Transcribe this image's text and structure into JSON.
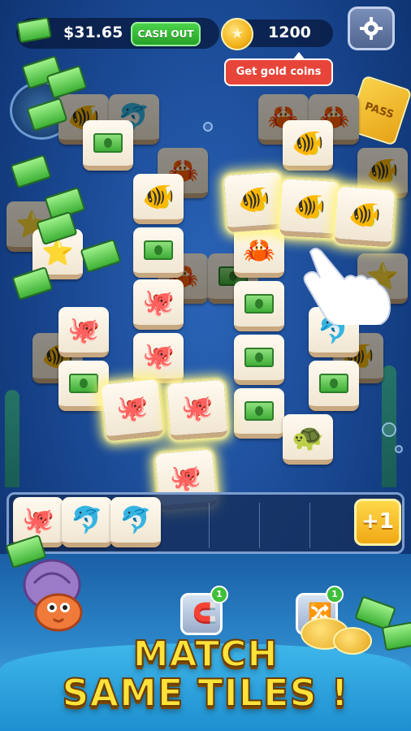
{
  "hud": {
    "cash_value": "$31.65",
    "cashout_label": "CASH OUT",
    "coin_value": "1200",
    "tooltip": "Get gold coins",
    "pass_label": "PASS"
  },
  "tray": {
    "plus_label": "+1",
    "tiles": [
      "squid",
      "dolphin",
      "dolphin"
    ]
  },
  "headline": {
    "line1": "MATCH",
    "line2": "SAME TILES !"
  },
  "powerups": [
    {
      "name": "magnet",
      "count": "1"
    },
    {
      "name": "shuffle",
      "count": "1"
    }
  ],
  "colors": {
    "background": "#1b4a95",
    "accent_green": "#27a227",
    "accent_gold": "#f1a814",
    "tooltip_red": "#e8453a"
  },
  "icons": {
    "fish": "fish-icon",
    "squid": "squid-icon",
    "dolphin": "dolphin-icon",
    "crab": "crab-icon",
    "starfish": "starfish-icon",
    "turtle": "turtle-icon",
    "cash": "cash-icon"
  }
}
